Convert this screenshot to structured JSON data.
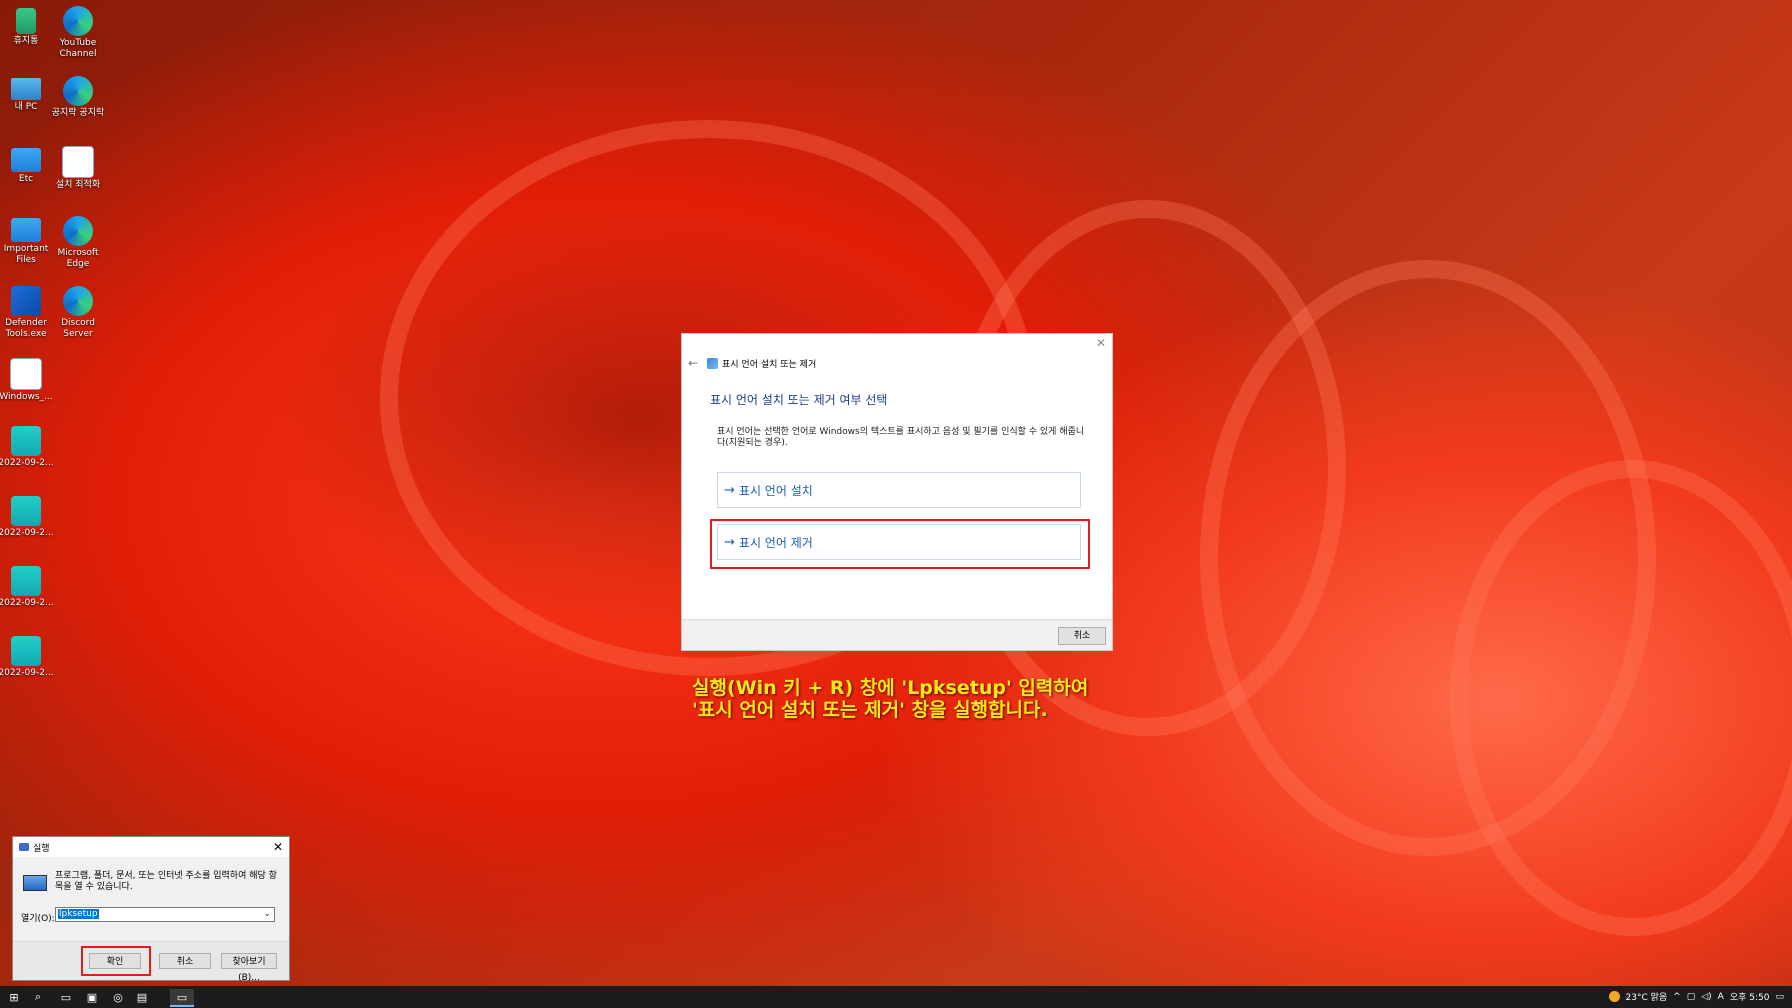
{
  "desktop": {
    "icons": [
      {
        "label": "휴지통",
        "type": "recycle-bin-icon"
      },
      {
        "label": "YouTube Channel",
        "type": "edge-icon"
      },
      {
        "label": "내 PC",
        "type": "computer-icon"
      },
      {
        "label": "공지락 공지락",
        "type": "edge-icon"
      },
      {
        "label": "Etc",
        "type": "folder-icon"
      },
      {
        "label": "설치 최적화",
        "type": "settings-icon"
      },
      {
        "label": "Important Files",
        "type": "folder-icon"
      },
      {
        "label": "Microsoft Edge",
        "type": "edge-icon"
      },
      {
        "label": "Defender Tools.exe",
        "type": "shield-icon"
      },
      {
        "label": "Discord Server",
        "type": "edge-icon"
      },
      {
        "label": "Windows_...",
        "type": "settings-icon"
      },
      {
        "label": "2022-09-2...",
        "type": "image-icon"
      },
      {
        "label": "2022-09-2...",
        "type": "image-icon"
      },
      {
        "label": "2022-09-2...",
        "type": "image-icon"
      },
      {
        "label": "2022-09-2...",
        "type": "image-icon"
      }
    ]
  },
  "lpk_dialog": {
    "title": "표시 언어 설치 또는 제거",
    "heading": "표시 언어 설치 또는 제거 여부 선택",
    "description": "표시 언어는 선택한 언어로 Windows의 텍스트를 표시하고 음성 및 필기를 인식할 수 있게 해줍니다(지원되는 경우).",
    "option_install": "표시 언어 설치",
    "option_remove": "표시 언어 제거",
    "arrow": "→",
    "cancel": "취소",
    "close": "✕",
    "back": "←"
  },
  "caption": {
    "line1": "실행(Win 키 + R) 창에 'Lpksetup' 입력하여",
    "line2": "'표시 언어 설치 또는 제거' 창을 실행합니다."
  },
  "run_dialog": {
    "title": "실행",
    "description": "프로그램, 폴더, 문서, 또는 인터넷 주소를 입력하여 해당 항목을 열 수 있습니다.",
    "open_label": "열기(O):",
    "input_value": "lpksetup",
    "ok": "확인",
    "cancel": "취소",
    "browse": "찾아보기(B)...",
    "close": "✕"
  },
  "taskbar": {
    "weather": "23°C 맑음",
    "ime": "A",
    "time": "오후 5:50"
  },
  "colors": {
    "highlight": "#e51c1c",
    "caption": "#f7e81a",
    "link": "#1a5fb0"
  }
}
